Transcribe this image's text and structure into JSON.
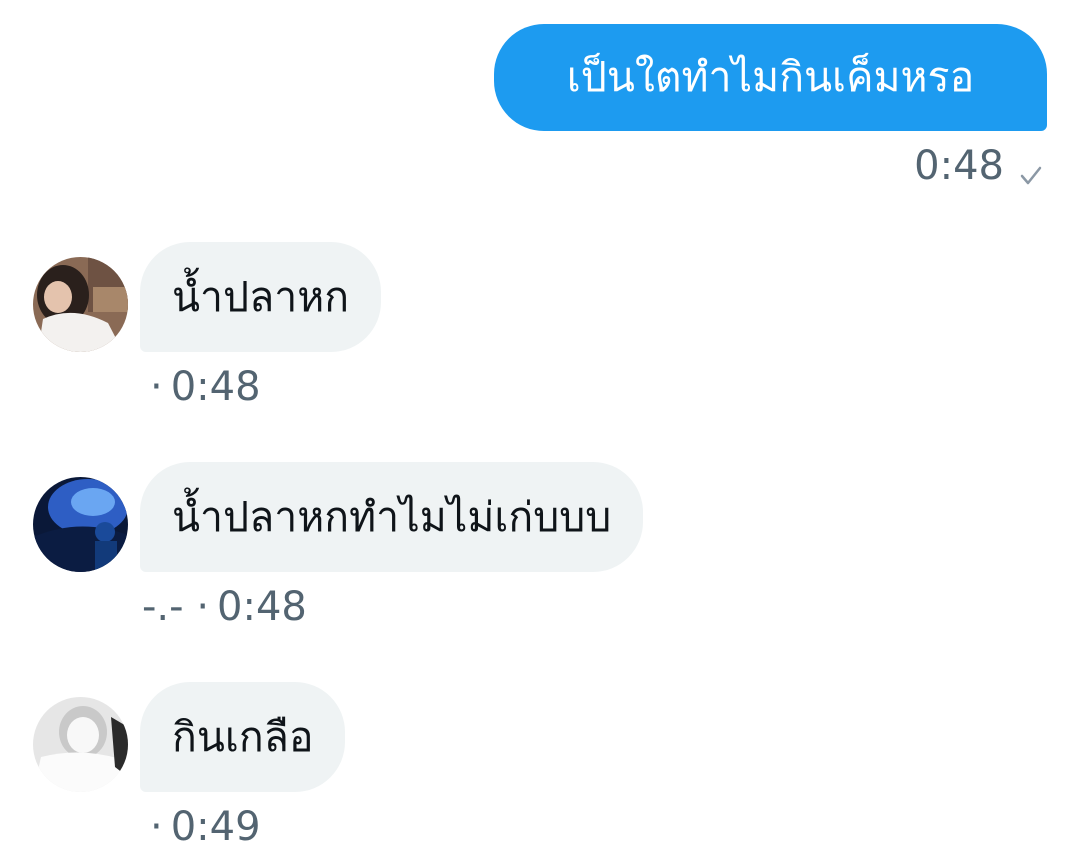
{
  "colors": {
    "sent_bubble": "#1d9bf0",
    "received_bubble": "#eff3f4",
    "meta_text": "#536471",
    "message_text": "#0f1419"
  },
  "messages": [
    {
      "direction": "sent",
      "text": "เป็นใตทำไมกินเค็มหรอ",
      "time": "0:48",
      "status_icon": "check-icon"
    },
    {
      "direction": "received",
      "text": "น้ำปลาหก",
      "sender_name": "",
      "separator": "·",
      "time": "0:48",
      "avatar_icon": "avatar-person-white-shirt"
    },
    {
      "direction": "received",
      "text": "น้ำปลาหกทำไมไม่เก่บบบ",
      "sender_name": "-.-",
      "separator": "·",
      "time": "0:48",
      "avatar_icon": "avatar-blue-aquarium"
    },
    {
      "direction": "received",
      "text": "กินเกลือ",
      "sender_name": "",
      "separator": "·",
      "time": "0:49",
      "avatar_icon": "avatar-grayscale-photo"
    }
  ]
}
